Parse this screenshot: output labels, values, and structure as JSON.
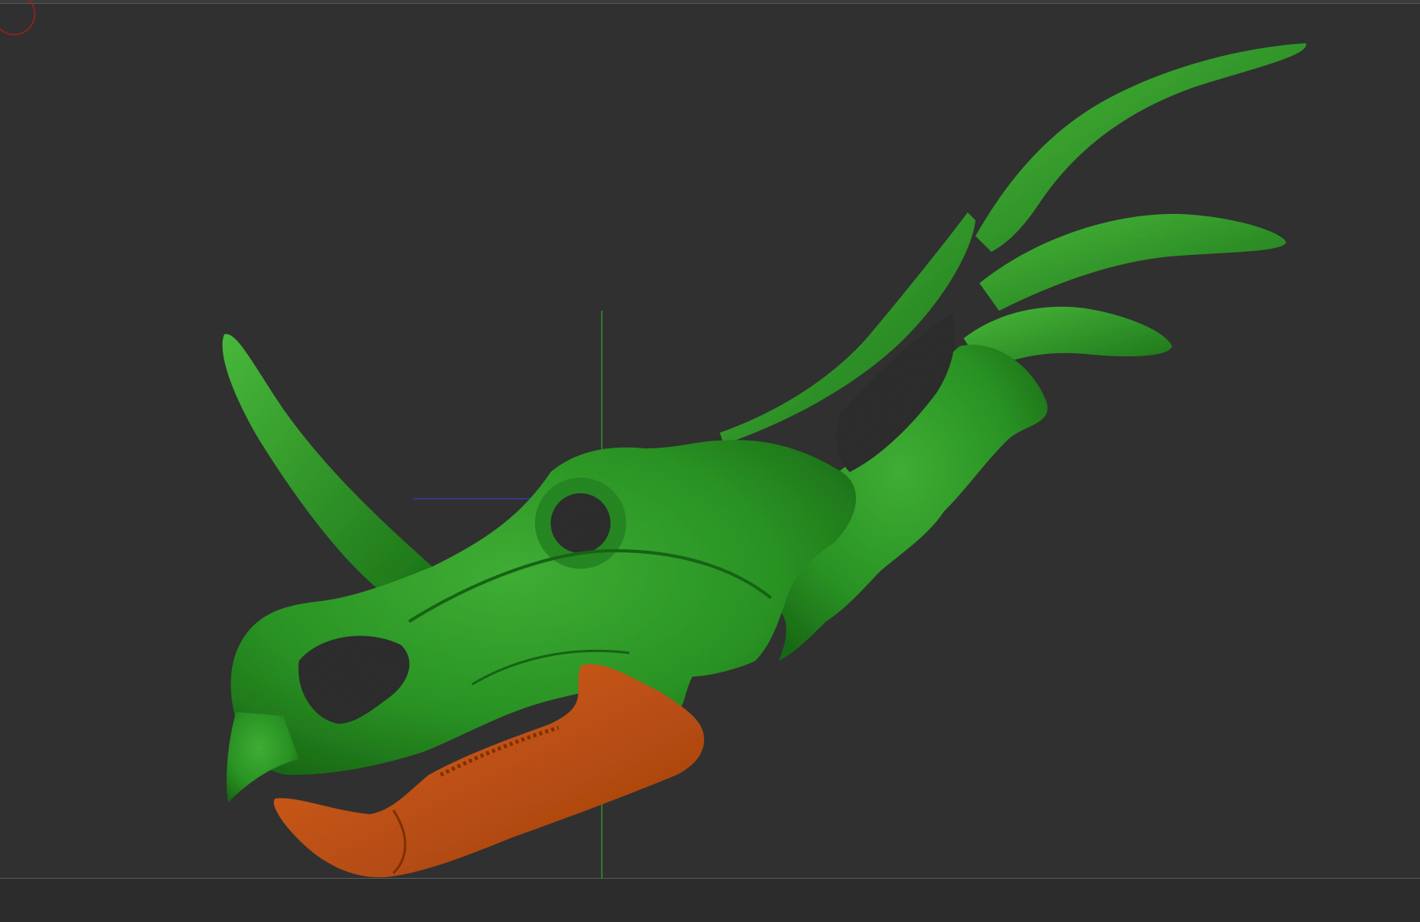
{
  "viewport": {
    "background": "#303030",
    "model": {
      "name": "",
      "colors": {
        "skull": "#2fa32a",
        "skull_shadow": "#1f7a1c",
        "skull_highlight": "#4cc23f",
        "jaw": "#d8581c",
        "jaw_shadow": "#9c3d12"
      }
    },
    "gizmo": {
      "origin_icon": "corner-circle-icon",
      "vertical_axis_color": "#2f8f2f",
      "horizontal_axis_color": "#3a3aa0",
      "corner_marker_color": "#a02020"
    }
  }
}
